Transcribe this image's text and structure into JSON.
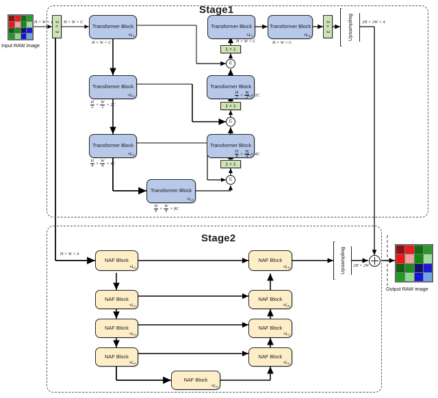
{
  "figure": {
    "title_stage1": "Stage1",
    "title_stage2": "Stage2",
    "input_caption": "Input RAW image",
    "output_caption": "Output RAW image"
  },
  "ops": {
    "concat": "C",
    "add": "+"
  },
  "conv": {
    "input_conv": "3 × 3",
    "output_conv": "3 × 3",
    "skip_conv": "1 × 1"
  },
  "upsampling": {
    "stage1_label": "Upsampling",
    "stage2_label": "Upsampling"
  },
  "stage1": {
    "blocks": [
      {
        "id": "t-enc-1",
        "label": "Transformer Block",
        "mult": "×L₁"
      },
      {
        "id": "t-enc-2",
        "label": "Transformer Block",
        "mult": "×L₂"
      },
      {
        "id": "t-enc-3",
        "label": "Transformer Block",
        "mult": "×L₃"
      },
      {
        "id": "t-bottleneck",
        "label": "Transformer Block",
        "mult": "×L₄"
      },
      {
        "id": "t-dec-3",
        "label": "Transformer Block",
        "mult": "×L₅"
      },
      {
        "id": "t-dec-2",
        "label": "Transformer Block",
        "mult": "×L₆"
      },
      {
        "id": "t-dec-1",
        "label": "Transformer Block",
        "mult": "×L₇"
      },
      {
        "id": "t-refine",
        "label": "Transformer Block",
        "mult": "×L₈"
      }
    ],
    "dims": {
      "input": "H × W × 1",
      "after_conv": "H × W × C",
      "level1": "H × W × C",
      "level2_num": "H",
      "level2_den": "2",
      "level2_num2": "W",
      "level2_den2": "2",
      "level2_ch": "× 2C",
      "level3_num": "H",
      "level3_den": "4",
      "level3_num2": "W",
      "level3_den2": "4",
      "level3_ch": "× 4C",
      "level4_num": "H",
      "level4_den": "8",
      "level4_num2": "W",
      "level4_den2": "8",
      "level4_ch": "× 8C",
      "dec1": "H × W × C",
      "dec_refine": "H × W × C",
      "upsampled": "2H × 2W × 4"
    }
  },
  "stage2": {
    "blocks": [
      {
        "id": "n-enc-1",
        "label": "NAF Block",
        "mult": "×L₁"
      },
      {
        "id": "n-enc-2",
        "label": "NAF Block",
        "mult": "×L₂"
      },
      {
        "id": "n-enc-3",
        "label": "NAF Block",
        "mult": "×L₃"
      },
      {
        "id": "n-enc-4",
        "label": "NAF Block",
        "mult": "×L₄"
      },
      {
        "id": "n-bottleneck",
        "label": "NAF Block",
        "mult": "×L₅"
      },
      {
        "id": "n-dec-4",
        "label": "NAF Block",
        "mult": "×L₆"
      },
      {
        "id": "n-dec-3",
        "label": "NAF Block",
        "mult": "×L₇"
      },
      {
        "id": "n-dec-2",
        "label": "NAF Block",
        "mult": "×L₈"
      },
      {
        "id": "n-dec-1",
        "label": "NAF Block",
        "mult": "×L₉"
      }
    ],
    "dims": {
      "input": "H × W × 4",
      "output": "2H × 2W × 4"
    }
  },
  "bayer": {
    "input_cells": [
      "#8f1212",
      "#e81d1d",
      "#136b13",
      "#2a9a2a",
      "#f01414",
      "#f5a0a0",
      "#0f8b0f",
      "#a3dba3",
      "#155c15",
      "#1e8a1e",
      "#101070",
      "#1a1ad0",
      "#1f9b1f",
      "#8fd98f",
      "#1414d8",
      "#6ea6ea"
    ],
    "output_cells": [
      "#8f1212",
      "#e81d1d",
      "#136b13",
      "#2a9a2a",
      "#f01414",
      "#f5a0a0",
      "#0f8b0f",
      "#a3dba3",
      "#155c15",
      "#1e8a1e",
      "#101070",
      "#1a1ad0",
      "#1f9b1f",
      "#8fd98f",
      "#1414d8",
      "#6ea6ea"
    ]
  },
  "colors": {
    "transformer_block": "#b8c8e8",
    "naf_block": "#fdeec7",
    "conv_chip": "#cfe4b6",
    "frame_border": "#555555",
    "wire": "#000000"
  }
}
